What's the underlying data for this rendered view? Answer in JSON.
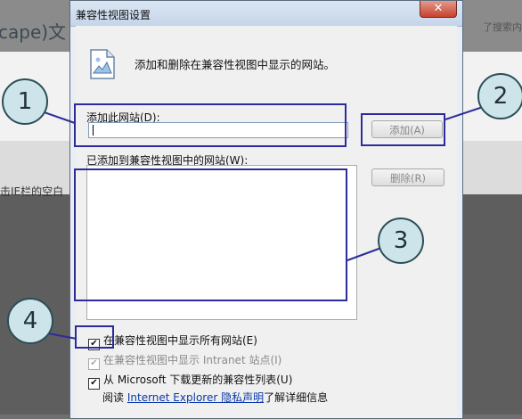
{
  "background": {
    "left_title": "cape)文",
    "left_text": "击IE栏的空白",
    "right_text": "了搜索内"
  },
  "dialog": {
    "title": "兼容性视图设置",
    "close_icon": "close-icon",
    "page_icon": "webpage-icon",
    "intro": "添加和删除在兼容性视图中显示的网站。",
    "add_label": "添加此网站(D):",
    "add_input_value": "",
    "add_button": "添加(A)",
    "list_label": "已添加到兼容性视图中的网站(W):",
    "delete_button": "删除(R)",
    "checkboxes": [
      {
        "label": "在兼容性视图中显示所有网站(E)",
        "checked": true,
        "enabled": true
      },
      {
        "label": "在兼容性视图中显示 Intranet 站点(I)",
        "checked": true,
        "enabled": false
      },
      {
        "label": "从 Microsoft 下载更新的兼容性列表(U)",
        "checked": true,
        "enabled": true
      }
    ],
    "read_prefix": "阅读",
    "read_link": "Internet Explorer 隐私声明",
    "read_suffix": "了解详细信息"
  },
  "annotations": [
    "1",
    "2",
    "3",
    "4"
  ],
  "colors": {
    "annotation_box": "#2b2c9a",
    "bubble_fill": "#cde5ea",
    "link": "#0b39a8"
  }
}
